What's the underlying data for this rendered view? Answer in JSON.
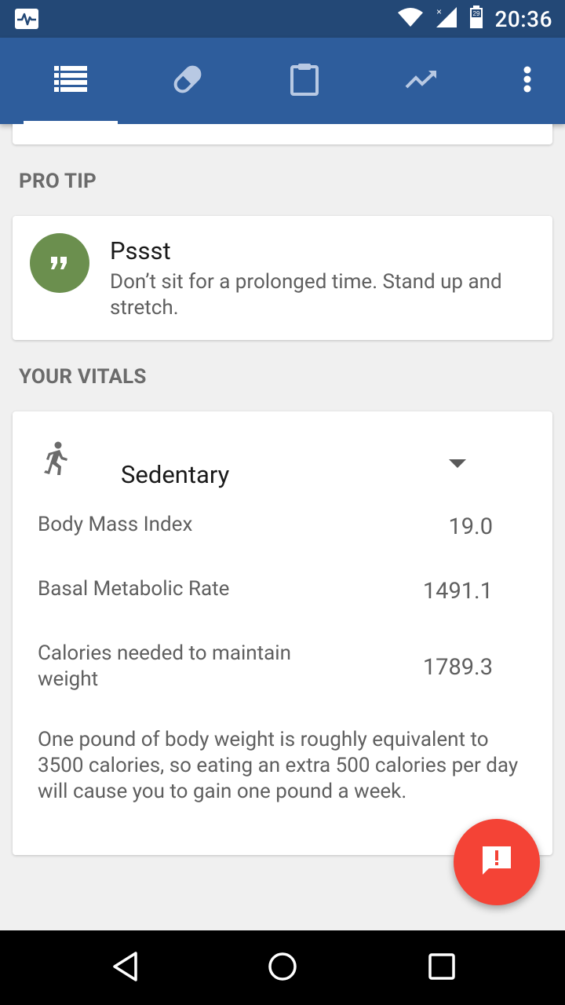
{
  "status_bar": {
    "time": "20:36",
    "battery_level": "29",
    "icons": [
      "health-pulse-icon",
      "wifi-icon",
      "cell-signal-icon",
      "battery-icon"
    ]
  },
  "app_bar": {
    "tabs": [
      {
        "icon": "list-icon",
        "active": true
      },
      {
        "icon": "pill-icon",
        "active": false
      },
      {
        "icon": "clipboard-icon",
        "active": false
      },
      {
        "icon": "trending-up-icon",
        "active": false
      }
    ],
    "overflow_icon": "more-vert-icon"
  },
  "pro_tip": {
    "header": "PRO TIP",
    "title": "Pssst",
    "body": "Don’t sit for a prolonged time. Stand up and stretch.",
    "avatar_color": "#6b8f4e"
  },
  "vitals": {
    "header": "YOUR VITALS",
    "activity_level": "Sedentary",
    "rows": [
      {
        "label": "Body Mass Index",
        "value": "19.0"
      },
      {
        "label": "Basal Metabolic Rate",
        "value": "1491.1"
      },
      {
        "label": "Calories needed to maintain weight",
        "value": "1789.3"
      }
    ],
    "note": "One pound of body weight is roughly equivalent to 3500 calories, so eating an extra 500 calories per day will cause you to gain one pound a week."
  },
  "fab": {
    "icon": "feedback-icon",
    "color": "#f44336"
  },
  "colors": {
    "status_bar": "#234876",
    "app_bar": "#2e5d9c",
    "background": "#f0f0f0"
  }
}
